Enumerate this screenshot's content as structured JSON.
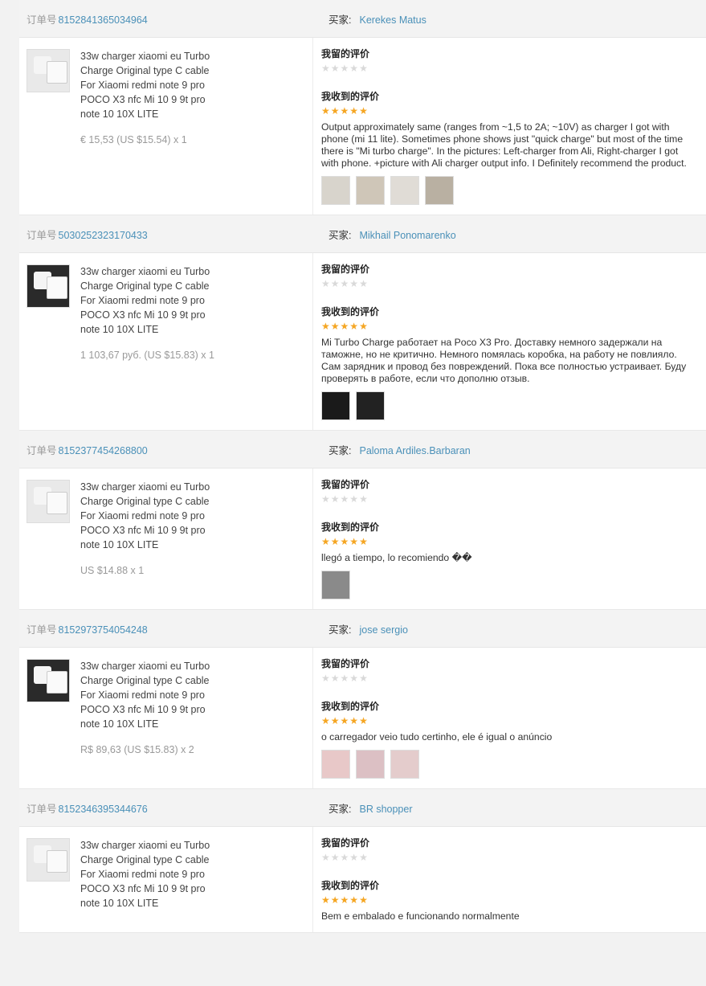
{
  "labels": {
    "order_no": "订单号",
    "buyer": "买家:",
    "my_review": "我留的评价",
    "received_review": "我收到的评价"
  },
  "colors": {
    "link": "#4a90b8",
    "star_on": "#f5a623",
    "star_off": "#d9d9d9"
  },
  "orders": [
    {
      "order_id": "8152841365034964",
      "buyer": "Kerekes Matus",
      "product_title": "33w charger xiaomi eu Turbo Charge Original type C cable For Xiaomi redmi note 9 pro POCO X3 nfc Mi 10 9 9t pro note 10 10X LITE",
      "price": "€ 15,53 (US $15.54) x 1",
      "my_stars": 0,
      "received_stars": 5,
      "review_text": "Output approximately same (ranges from ~1,5 to 2A; ~10V) as charger I got with phone (mi 11 lite). Sometimes phone shows just \"quick charge\" but most of the time there is \"Mi turbo charge\". In the pictures: Left-charger from Ali, Right-charger I got with phone. +picture with Ali charger output info. I Definitely recommend the product.",
      "photo_count": 4
    },
    {
      "order_id": "5030252323170433",
      "buyer": "Mikhail Ponomarenko",
      "product_title": "33w charger xiaomi eu Turbo Charge Original type C cable For Xiaomi redmi note 9 pro POCO X3 nfc Mi 10 9 9t pro note 10 10X LITE",
      "price": "1 103,67 руб. (US $15.83) x 1",
      "my_stars": 0,
      "received_stars": 5,
      "review_text": "Mi Turbo Charge работает на Poco X3 Pro. Доставку немного задержали на таможне, но не критично. Немного помялась коробка, на работу не повлияло. Сам зарядник и провод без повреждений. Пока все полностью устраивает. Буду проверять в работе, если что дополню отзыв.",
      "photo_count": 2
    },
    {
      "order_id": "8152377454268800",
      "buyer": "Paloma Ardiles.Barbaran",
      "product_title": "33w charger xiaomi eu Turbo Charge Original type C cable For Xiaomi redmi note 9 pro POCO X3 nfc Mi 10 9 9t pro note 10 10X LITE",
      "price": "US $14.88 x 1",
      "my_stars": 0,
      "received_stars": 5,
      "review_text": "llegó a tiempo, lo recomiendo ��",
      "photo_count": 1
    },
    {
      "order_id": "8152973754054248",
      "buyer": "jose sergio",
      "product_title": "33w charger xiaomi eu Turbo Charge Original type C cable For Xiaomi redmi note 9 pro POCO X3 nfc Mi 10 9 9t pro note 10 10X LITE",
      "price": "R$ 89,63 (US $15.83) x 2",
      "my_stars": 0,
      "received_stars": 5,
      "review_text": "o carregador veio tudo certinho, ele é igual o anúncio",
      "photo_count": 3
    },
    {
      "order_id": "8152346395344676",
      "buyer": "BR shopper",
      "product_title": "33w charger xiaomi eu Turbo Charge Original type C cable For Xiaomi redmi note 9 pro POCO X3 nfc Mi 10 9 9t pro note 10 10X LITE",
      "price": "",
      "my_stars": 0,
      "received_stars": 5,
      "review_text": "Bem e embalado e funcionando normalmente",
      "photo_count": 0
    }
  ]
}
